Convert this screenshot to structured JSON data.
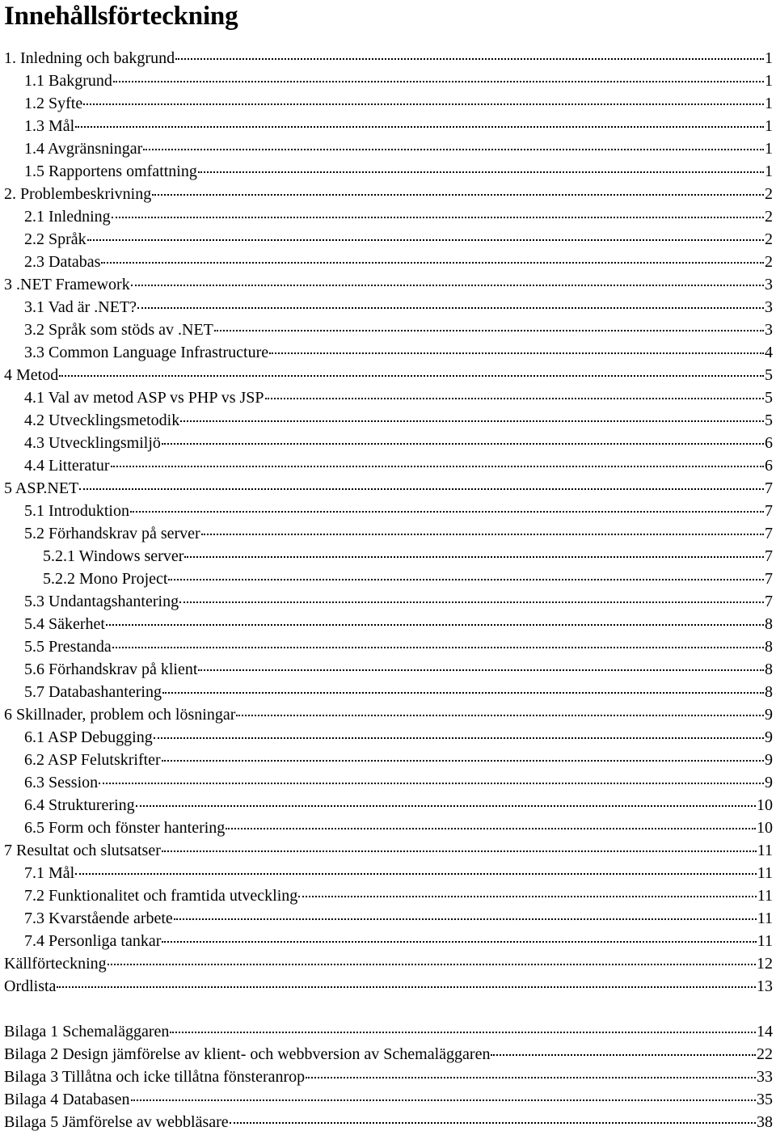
{
  "document": {
    "title": "Innehållsförteckning",
    "language": "sv"
  },
  "toc": {
    "leader_style": "dotted",
    "entries": [
      {
        "label": "1. Inledning och bakgrund",
        "page": "1",
        "level": 1
      },
      {
        "label": "1.1 Bakgrund",
        "page": "1",
        "level": 2
      },
      {
        "label": "1.2 Syfte",
        "page": "1",
        "level": 2
      },
      {
        "label": "1.3 Mål",
        "page": "1",
        "level": 2
      },
      {
        "label": "1.4 Avgränsningar",
        "page": "1",
        "level": 2
      },
      {
        "label": "1.5 Rapportens omfattning",
        "page": "1",
        "level": 2
      },
      {
        "label": "2. Problembeskrivning",
        "page": "2",
        "level": 1
      },
      {
        "label": "2.1 Inledning",
        "page": "2",
        "level": 2
      },
      {
        "label": "2.2 Språk",
        "page": "2",
        "level": 2
      },
      {
        "label": "2.3 Databas",
        "page": "2",
        "level": 2
      },
      {
        "label": "3 .NET Framework",
        "page": "3",
        "level": 1
      },
      {
        "label": "3.1 Vad är .NET?",
        "page": "3",
        "level": 2
      },
      {
        "label": "3.2 Språk som stöds av .NET",
        "page": "3",
        "level": 2
      },
      {
        "label": "3.3 Common Language Infrastructure",
        "page": "4",
        "level": 2
      },
      {
        "label": "4 Metod",
        "page": "5",
        "level": 1
      },
      {
        "label": "4.1 Val av metod ASP vs PHP vs JSP",
        "page": "5",
        "level": 2
      },
      {
        "label": "4.2 Utvecklingsmetodik",
        "page": "5",
        "level": 2
      },
      {
        "label": "4.3 Utvecklingsmiljö",
        "page": "6",
        "level": 2
      },
      {
        "label": "4.4 Litteratur",
        "page": "6",
        "level": 2
      },
      {
        "label": "5 ASP.NET",
        "page": "7",
        "level": 1
      },
      {
        "label": "5.1 Introduktion",
        "page": "7",
        "level": 2
      },
      {
        "label": "5.2 Förhandskrav på server",
        "page": "7",
        "level": 2
      },
      {
        "label": "5.2.1 Windows server",
        "page": "7",
        "level": 3
      },
      {
        "label": "5.2.2 Mono Project",
        "page": "7",
        "level": 3
      },
      {
        "label": "5.3 Undantagshantering",
        "page": "7",
        "level": 2
      },
      {
        "label": "5.4 Säkerhet",
        "page": "8",
        "level": 2
      },
      {
        "label": "5.5 Prestanda",
        "page": "8",
        "level": 2
      },
      {
        "label": "5.6 Förhandskrav på klient",
        "page": "8",
        "level": 2
      },
      {
        "label": "5.7 Databashantering",
        "page": "8",
        "level": 2
      },
      {
        "label": "6 Skillnader, problem och lösningar",
        "page": "9",
        "level": 1
      },
      {
        "label": "6.1 ASP Debugging",
        "page": "9",
        "level": 2
      },
      {
        "label": "6.2 ASP Felutskrifter",
        "page": "9",
        "level": 2
      },
      {
        "label": "6.3 Session",
        "page": "9",
        "level": 2
      },
      {
        "label": "6.4 Strukturering",
        "page": "10",
        "level": 2
      },
      {
        "label": "6.5 Form och fönster hantering",
        "page": "10",
        "level": 2
      },
      {
        "label": "7 Resultat och slutsatser",
        "page": "11",
        "level": 1
      },
      {
        "label": "7.1 Mål",
        "page": "11",
        "level": 2
      },
      {
        "label": "7.2 Funktionalitet och framtida utveckling",
        "page": "11",
        "level": 2
      },
      {
        "label": "7.3 Kvarstående arbete",
        "page": "11",
        "level": 2
      },
      {
        "label": "7.4 Personliga tankar",
        "page": "11",
        "level": 2
      },
      {
        "label": "Källförteckning",
        "page": "12",
        "level": 1
      },
      {
        "label": "Ordlista",
        "page": "13",
        "level": 1
      },
      {
        "label": "",
        "page": "",
        "level": 0,
        "spacer": true
      },
      {
        "label": "Bilaga 1 Schemaläggaren",
        "page": "14",
        "level": 1
      },
      {
        "label": "Bilaga 2 Design jämförelse av klient- och webbversion av Schemaläggaren",
        "page": "22",
        "level": 1
      },
      {
        "label": "Bilaga 3 Tillåtna och icke tillåtna fönsteranrop",
        "page": "33",
        "level": 1
      },
      {
        "label": "Bilaga 4 Databasen",
        "page": "35",
        "level": 1
      },
      {
        "label": "Bilaga 5 Jämförelse av webbläsare",
        "page": "38",
        "level": 1
      }
    ]
  }
}
